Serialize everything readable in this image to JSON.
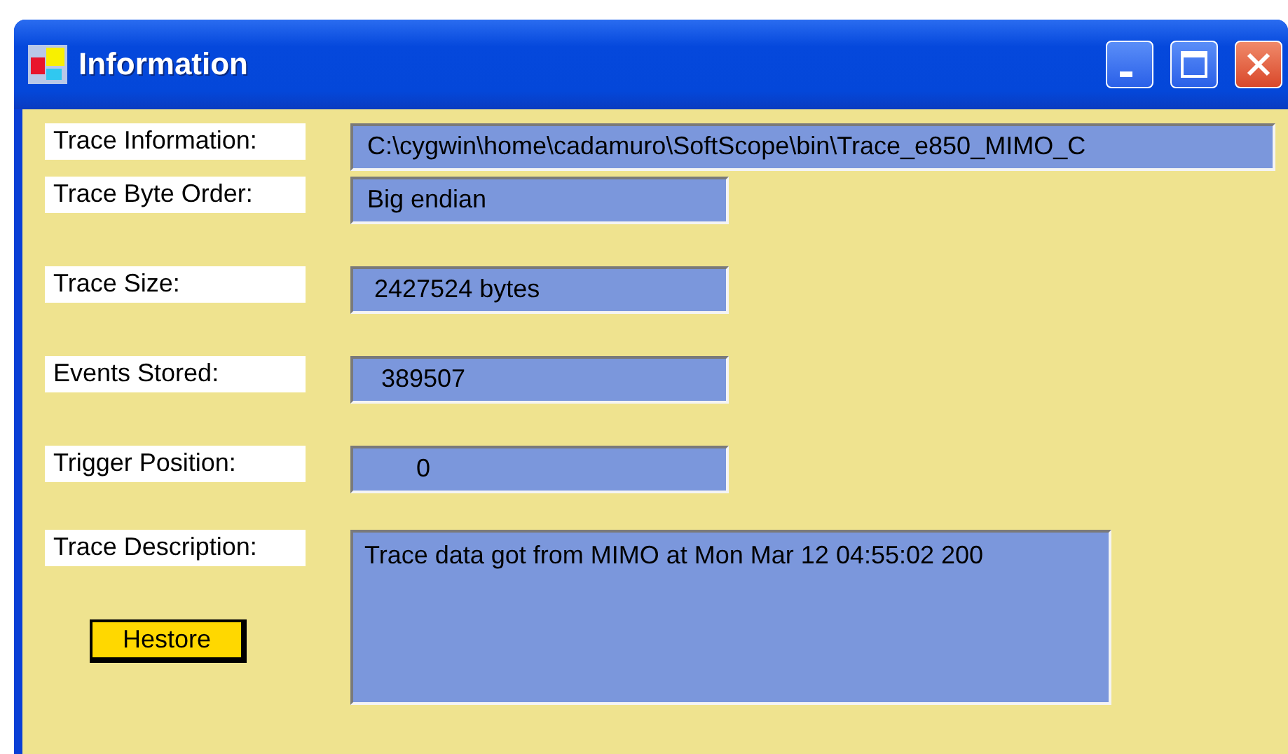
{
  "window": {
    "title": "Information"
  },
  "fields": [
    {
      "label": "Trace Information:",
      "value": "C:\\cygwin\\home\\cadamuro\\SoftScope\\bin\\Trace_e850_MIMO_C",
      "kind": "wide"
    },
    {
      "label": "Trace Byte Order:",
      "value": "Big endian",
      "kind": "short"
    },
    {
      "label": "Trace Size:",
      "value": " 2427524 bytes",
      "kind": "short"
    },
    {
      "label": "Events Stored:",
      "value": "  389507",
      "kind": "short"
    },
    {
      "label": "Trigger Position:",
      "value": "       0",
      "kind": "short"
    }
  ],
  "description": {
    "label": "Trace Description:",
    "value": "Trace data got from MIMO at Mon Mar 12 04:55:02 200"
  },
  "restore_button": {
    "label": "Hestore"
  }
}
